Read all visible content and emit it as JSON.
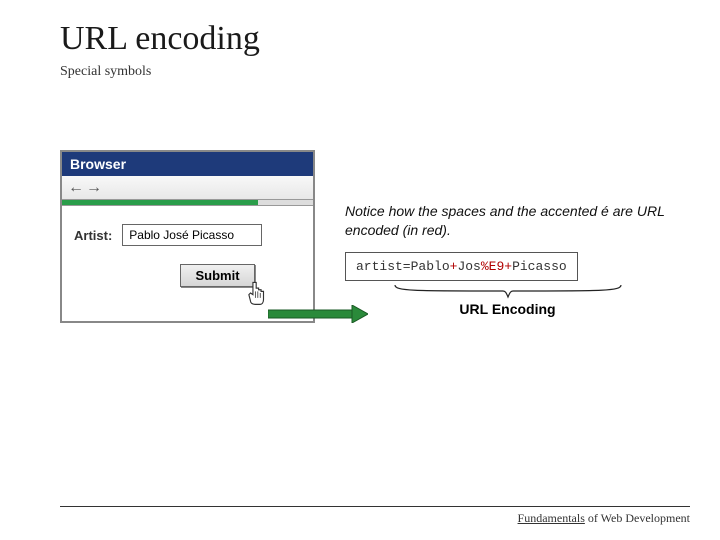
{
  "header": {
    "title": "URL encoding",
    "subtitle": "Special symbols"
  },
  "browser": {
    "title": "Browser",
    "form": {
      "label": "Artist:",
      "value": "Pablo José Picasso",
      "submit": "Submit"
    }
  },
  "notice": "Notice how the spaces and the accented é are URL encoded (in red).",
  "encoded": {
    "pre": "artist=Pablo",
    "r1": "+",
    "mid": "Jos",
    "r2": "%E9+",
    "post": "Picasso"
  },
  "enc_label": "URL Encoding",
  "footer": {
    "u1": "Fundamentals",
    "rest": " of Web Development"
  }
}
